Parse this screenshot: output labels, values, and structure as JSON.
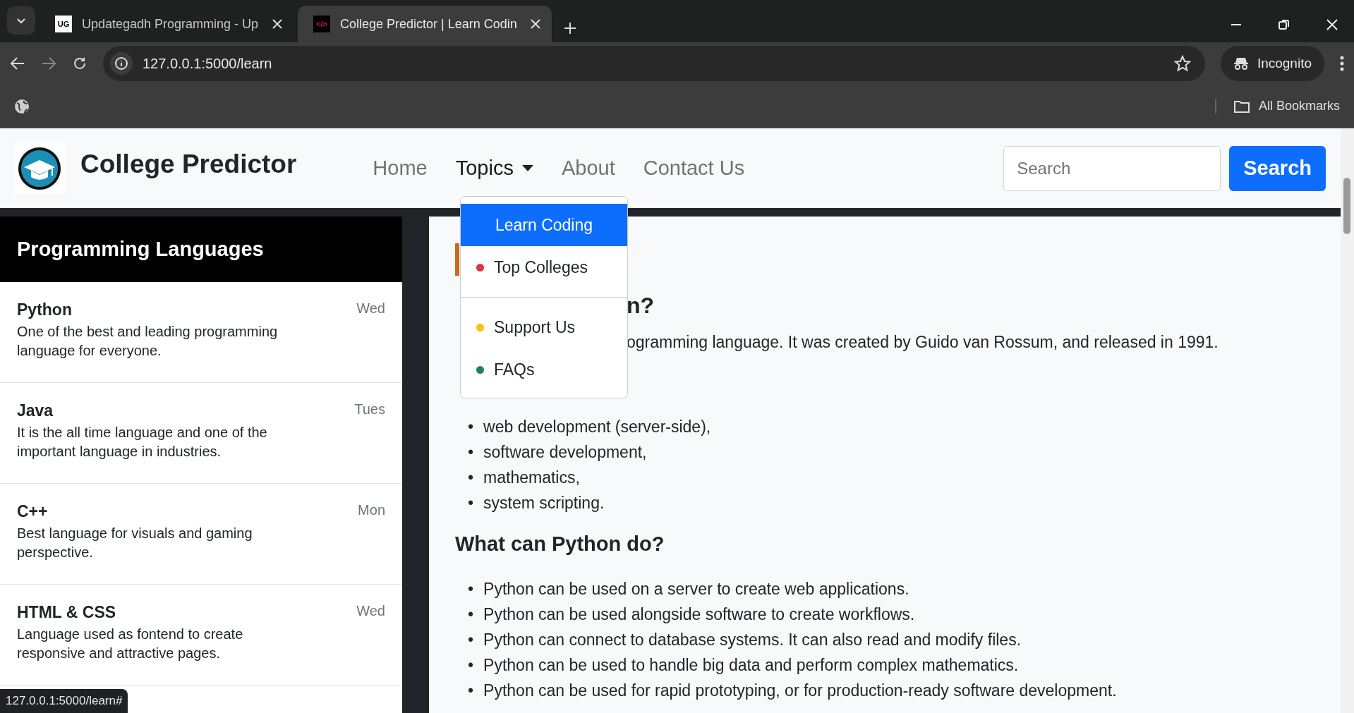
{
  "browser": {
    "tabs": [
      {
        "title": "Updategadh Programming - Up",
        "icon_text": "UG",
        "selected": false
      },
      {
        "title": "College Predictor | Learn Codin",
        "icon_text": "</>",
        "selected": true
      }
    ],
    "url": "127.0.0.1:5000/learn",
    "profile": "Incognito",
    "bookmarks": "All Bookmarks",
    "status_url": "127.0.0.1:5000/learn#"
  },
  "navbar": {
    "brand": "College Predictor",
    "links": [
      {
        "label": "Home",
        "selected": false,
        "dropdown": false
      },
      {
        "label": "Topics",
        "selected": true,
        "dropdown": true
      },
      {
        "label": "About",
        "selected": false,
        "dropdown": false
      },
      {
        "label": "Contact Us",
        "selected": false,
        "dropdown": false
      }
    ],
    "search": {
      "placeholder": "Search",
      "button": "Search"
    }
  },
  "dropdown": [
    {
      "kind": "link",
      "label": "Learn Coding",
      "selected": true
    },
    {
      "kind": "link",
      "label": "Top Colleges",
      "selected": false,
      "color": "#dc3545"
    },
    {
      "kind": "divider"
    },
    {
      "kind": "link",
      "label": "Support Us",
      "selected": false,
      "color": "#ffc107"
    },
    {
      "kind": "link",
      "label": "FAQs",
      "selected": false,
      "color": "#198754"
    }
  ],
  "sidebar": {
    "title": "Programming Languages",
    "items": [
      {
        "name": "Python",
        "description": "One of the best and leading programming language for everyone.",
        "day": "Wed"
      },
      {
        "name": "Java",
        "description": "It is the all time language and one of the important language in industries.",
        "day": "Tues"
      },
      {
        "name": "C++",
        "description": "Best language for visuals and gaming perspective.",
        "day": "Mon"
      },
      {
        "name": "HTML & CSS",
        "description": "Language used as fontend to create responsive and attractive pages.",
        "day": "Wed"
      }
    ]
  },
  "content": {
    "heading_tail": "n?",
    "intro_tail": "ogramming language. It was created by Guido van Rossum, and released in 1991.",
    "marker": "•",
    "uses": [
      "web development (server-side),",
      "software development,",
      "mathematics,",
      "system scripting."
    ],
    "section_heading": "What can Python do?",
    "capabilities": [
      "Python can be used on a server to create web applications.",
      "Python can be used alongside software to create workflows.",
      "Python can connect to database systems. It can also read and modify files.",
      "Python can be used to handle big data and perform complex mathematics.",
      "Python can be used for rapid prototyping, or for production-ready software development."
    ]
  }
}
